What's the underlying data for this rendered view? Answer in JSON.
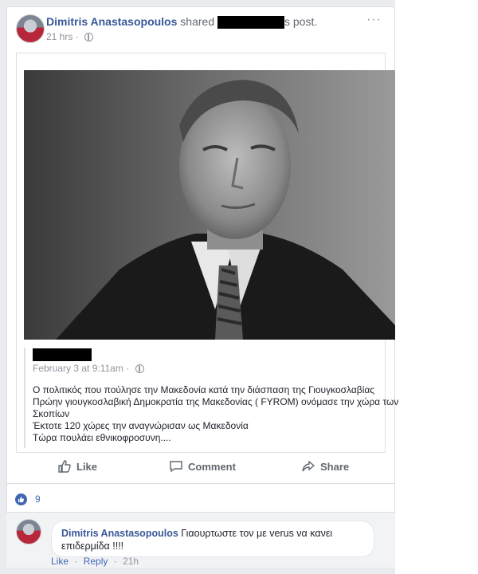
{
  "post": {
    "author": "Dimitris Anastasopoulos",
    "shared_word": "shared",
    "post_suffix": "s post.",
    "time": "21 hrs",
    "more_label": "···"
  },
  "shared_post": {
    "time": "February 3 at 9:11am",
    "text_lines": [
      "Ο πολιτικός που πούλησε την Μακεδονία κατά την διάσπαση της Γιουγκοσλαβίας",
      "Πρώην γιουγκοσλαβική Δημοκρατία της Μακεδονίας ( FYROM) ονόμασε την χώρα των",
      "Σκοπίων",
      "Έκτοτε 120 χώρες την αναγνώρισαν ως Μακεδονία",
      "Τώρα πουλάει εθνικοφροσυνη...."
    ]
  },
  "actions": {
    "like": "Like",
    "comment": "Comment",
    "share": "Share"
  },
  "reactions": {
    "count": "9"
  },
  "comment": {
    "author": "Dimitris Anastasopoulos",
    "text_line1": "Γιαουρτωστε τον με verus να κανει",
    "text_line2": "επιδερμίδα !!!!",
    "like": "Like",
    "reply": "Reply",
    "time": "21h"
  },
  "colors": {
    "link": "#365899",
    "accent": "#4267b2",
    "muted": "#90949c"
  }
}
